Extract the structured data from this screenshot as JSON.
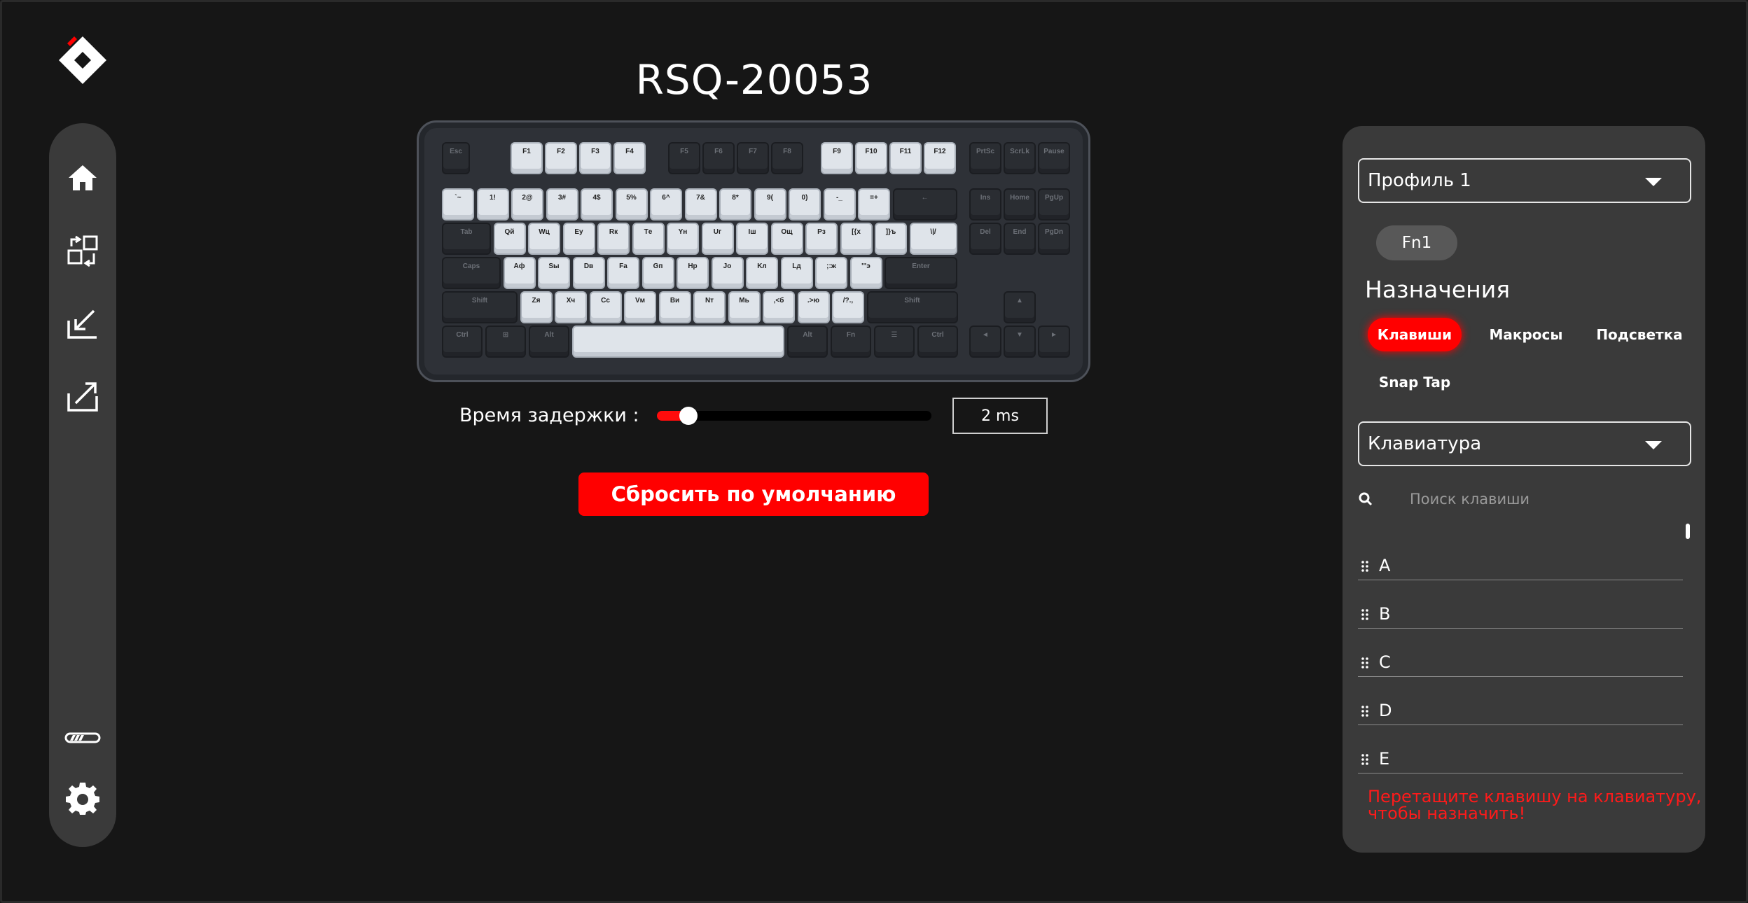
{
  "app": {
    "title": "RSQ-20053"
  },
  "sidebar": {
    "items": [
      {
        "name": "home-icon"
      },
      {
        "name": "swap-profiles-icon"
      },
      {
        "name": "import-icon"
      },
      {
        "name": "export-icon"
      },
      {
        "name": "battery-icon"
      },
      {
        "name": "gear-icon"
      }
    ]
  },
  "keyboard": {
    "fkeys": [
      "Esc",
      "F1",
      "F2",
      "F3",
      "F4",
      "F5",
      "F6",
      "F7",
      "F8",
      "F9",
      "F10",
      "F11",
      "F12",
      "PrtSc",
      "ScrLk",
      "Pause"
    ],
    "row1": [
      "`~",
      "1!",
      "2@",
      "3#",
      "4$",
      "5%",
      "6^",
      "7&",
      "8*",
      "9(",
      "0)",
      "-_",
      "=+",
      "←"
    ],
    "row1_nav": [
      "Ins",
      "Home",
      "PgUp"
    ],
    "row2": [
      "Tab",
      "Qй",
      "Wц",
      "Eу",
      "Rк",
      "Tе",
      "Yн",
      "Uг",
      "Iш",
      "Oщ",
      "Pз",
      "[{х",
      "]}ъ",
      "\\|/"
    ],
    "row2_nav": [
      "Del",
      "End",
      "PgDn"
    ],
    "row3": [
      "Caps",
      "Aф",
      "Sы",
      "Dв",
      "Fа",
      "Gп",
      "Hр",
      "Jо",
      "Kл",
      "Lд",
      ";:ж",
      "'\"э",
      "Enter"
    ],
    "row4": [
      "Shift",
      "Zя",
      "Xч",
      "Cс",
      "Vм",
      "Bи",
      "Nт",
      "Mь",
      ",<б",
      ".>ю",
      "/?.,",
      "Shift"
    ],
    "row4_nav": [
      "▲"
    ],
    "row5": [
      "Ctrl",
      "⊞",
      "Alt",
      "",
      "Alt",
      "Fn",
      "☰",
      "Ctrl"
    ],
    "row5_nav": [
      "◄",
      "▼",
      "►"
    ]
  },
  "delay": {
    "label": "Время задержки :",
    "value": "2 ms",
    "level": 0.1
  },
  "reset": {
    "label": "Сбросить по умолчанию"
  },
  "panel": {
    "profile_select": "Профиль 1",
    "fn_chip": "Fn1",
    "assign_title": "Назначения",
    "tabs": [
      "Клавиши",
      "Макросы",
      "Подсветка",
      "Snap Tap"
    ],
    "active_tab": "Клавиши",
    "category_select": "Клавиатура",
    "search_placeholder": "Поиск клавиши",
    "key_list": [
      "A",
      "B",
      "C",
      "D",
      "E"
    ],
    "hint": "Перетащите клавишу на клавиатуру, чтобы назначить!"
  },
  "colors": {
    "accent": "#ff0000",
    "background": "#161616",
    "panel": "#3a3a3a"
  }
}
